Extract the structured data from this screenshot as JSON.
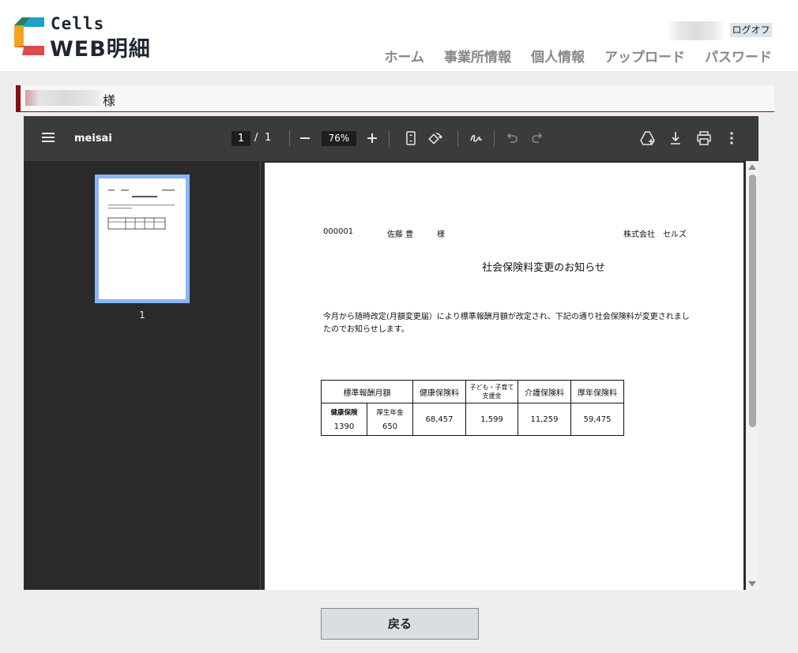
{
  "header": {
    "logo_top": "Cells",
    "logo_bottom": "WEB明細",
    "logout_label": "ログオフ",
    "nav": [
      "ホーム",
      "事業所情報",
      "個人情報",
      "アップロード",
      "パスワード"
    ]
  },
  "name_bar": {
    "suffix": "様"
  },
  "viewer": {
    "doc_name": "meisai",
    "page_current": "1",
    "page_separator": "/",
    "page_total": "1",
    "zoom": "76%",
    "thumbnail_label": "1"
  },
  "document": {
    "employee_id": "000001",
    "employee_name": "佐藤 豊",
    "honorific": "様",
    "company": "株式会社　セルズ",
    "title": "社会保険料変更のお知らせ",
    "body": "今月から随時改定(月額変更届）により標準報酬月額が改定され、下記の通り社会保険料が変更されましたのでお知らせします。",
    "table": {
      "headers": [
        "標準報酬月額",
        "健康保険料",
        "子ども・子育て支援金",
        "介護保険料",
        "厚年保険料"
      ],
      "sub_headers": [
        "健康保険",
        "厚生年金"
      ],
      "sub_values": [
        "1390",
        "650"
      ],
      "values": [
        "68,457",
        "1,599",
        "11,259",
        "59,475"
      ]
    }
  },
  "back_label": "戻る",
  "colors": {
    "accent": "#8b0e14",
    "thumb_border": "#8ab4f8",
    "toolbar": "#3b3b3c"
  }
}
